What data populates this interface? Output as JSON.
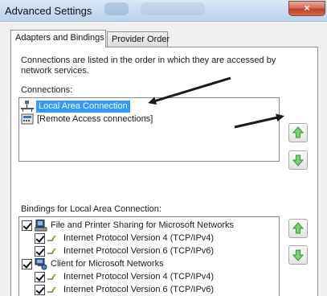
{
  "window": {
    "title": "Advanced Settings",
    "close_glyph": "×"
  },
  "tabs": [
    {
      "label": "Adapters and Bindings",
      "active": true
    },
    {
      "label": "Provider Order",
      "active": false
    }
  ],
  "description": "Connections are listed in the order in which they are accessed by network services.",
  "connections": {
    "label": "Connections:",
    "items": [
      {
        "label": "Local Area Connection",
        "icon": "network-adapter-icon",
        "selected": true
      },
      {
        "label": "[Remote Access connections]",
        "icon": "modem-icon",
        "selected": false
      }
    ]
  },
  "bindings": {
    "label": "Bindings for Local Area Connection:",
    "items": [
      {
        "label": "File and Printer Sharing for Microsoft Networks",
        "icon": "file-printer-sharing-icon",
        "checked": true,
        "level": 0
      },
      {
        "label": "Internet Protocol Version 4 (TCP/IPv4)",
        "icon": "protocol-icon",
        "checked": true,
        "level": 1
      },
      {
        "label": "Internet Protocol Version 6 (TCP/IPv6)",
        "icon": "protocol-icon",
        "checked": true,
        "level": 1
      },
      {
        "label": "Client for Microsoft Networks",
        "icon": "network-client-icon",
        "checked": true,
        "level": 0
      },
      {
        "label": "Internet Protocol Version 4 (TCP/IPv4)",
        "icon": "protocol-icon",
        "checked": true,
        "level": 1
      },
      {
        "label": "Internet Protocol Version 6 (TCP/IPv6)",
        "icon": "protocol-icon",
        "checked": true,
        "level": 1
      }
    ]
  },
  "colors": {
    "selection": "#3399ff",
    "arrow_green": "#2f9a2f",
    "close_red": "#c0412b"
  }
}
